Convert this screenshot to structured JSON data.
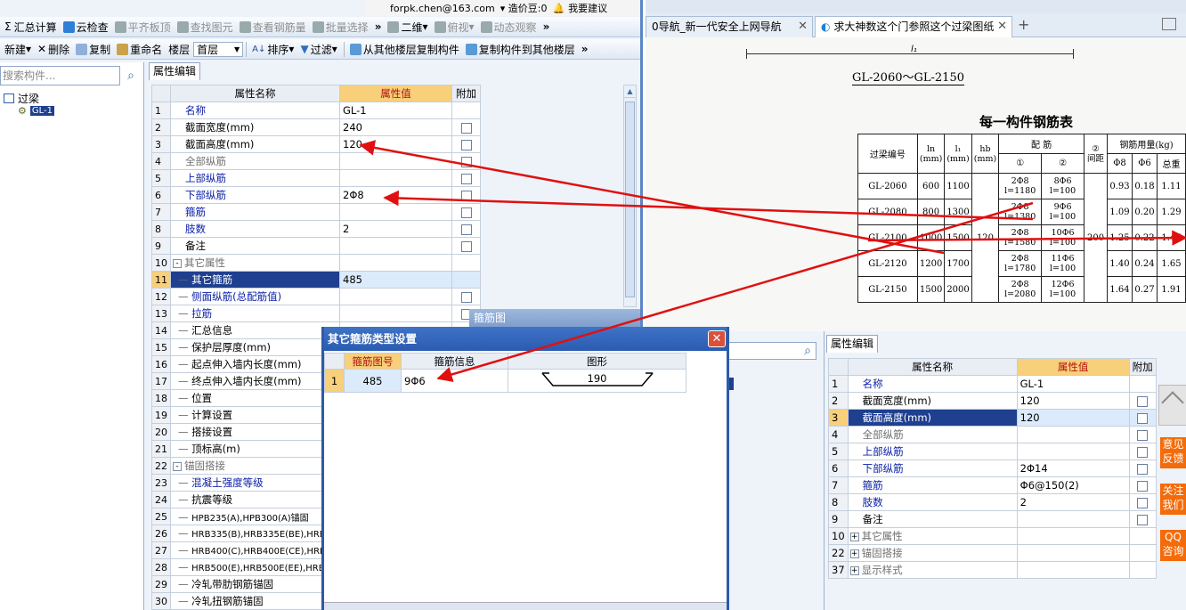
{
  "left_app": {
    "email": "forpk.chen@163.com",
    "email_suffix": "▾ 造价豆:0",
    "suggest": "我要建议",
    "toolbar1": [
      "汇总计算",
      "云检查",
      "平齐板顶",
      "查找图元",
      "查看钢筋量",
      "批量选择",
      "二维",
      "俯视",
      "动态观察"
    ],
    "toolbar2": {
      "new": "新建",
      "delete": "删除",
      "copy": "复制",
      "rename": "重命名",
      "floor_label": "楼层",
      "floor_value": "首层",
      "sort": "排序",
      "filter": "过滤",
      "copy_from": "从其他楼层复制构件",
      "copy_to": "复制构件到其他楼层"
    },
    "search_placeholder": "搜索构件...",
    "tree": {
      "root": "过梁",
      "child": "GL-1"
    },
    "prop_tab": "属性编辑",
    "grid_headers": [
      "属性名称",
      "属性值",
      "附加"
    ],
    "rows": [
      {
        "n": "1",
        "name": "名称",
        "val": "GL-1",
        "cls": "blue",
        "cb": false
      },
      {
        "n": "2",
        "name": "截面宽度(mm)",
        "val": "240",
        "cls": "",
        "cb": true
      },
      {
        "n": "3",
        "name": "截面高度(mm)",
        "val": "120",
        "cls": "",
        "cb": true
      },
      {
        "n": "4",
        "name": "全部纵筋",
        "val": "",
        "cls": "gray",
        "cb": true
      },
      {
        "n": "5",
        "name": "上部纵筋",
        "val": "",
        "cls": "blue",
        "cb": true
      },
      {
        "n": "6",
        "name": "下部纵筋",
        "val": "2Φ8",
        "cls": "blue",
        "cb": true
      },
      {
        "n": "7",
        "name": "箍筋",
        "val": "",
        "cls": "blue",
        "cb": true
      },
      {
        "n": "8",
        "name": "肢数",
        "val": "2",
        "cls": "blue",
        "cb": true
      },
      {
        "n": "9",
        "name": "备注",
        "val": "",
        "cls": "",
        "cb": true
      },
      {
        "n": "10",
        "name": "其它属性",
        "val": "",
        "cls": "gray",
        "cb": false,
        "group": "-"
      },
      {
        "n": "11",
        "name": "其它箍筋",
        "val": "485",
        "cls": "",
        "cb": false,
        "indent": true,
        "hl": true
      },
      {
        "n": "12",
        "name": "侧面纵筋(总配筋值)",
        "val": "",
        "cls": "blue",
        "cb": true,
        "indent": true
      },
      {
        "n": "13",
        "name": "拉筋",
        "val": "",
        "cls": "blue",
        "cb": true,
        "indent": true
      },
      {
        "n": "14",
        "name": "汇总信息",
        "val": "",
        "cls": "",
        "cb": false,
        "indent": true
      },
      {
        "n": "15",
        "name": "保护层厚度(mm)",
        "val": "",
        "cls": "",
        "cb": false,
        "indent": true
      },
      {
        "n": "16",
        "name": "起点伸入墙内长度(mm)",
        "val": "",
        "cls": "",
        "cb": false,
        "indent": true
      },
      {
        "n": "17",
        "name": "终点伸入墙内长度(mm)",
        "val": "",
        "cls": "",
        "cb": false,
        "indent": true
      },
      {
        "n": "18",
        "name": "位置",
        "val": "",
        "cls": "",
        "cb": false,
        "indent": true
      },
      {
        "n": "19",
        "name": "计算设置",
        "val": "",
        "cls": "",
        "cb": false,
        "indent": true
      },
      {
        "n": "20",
        "name": "搭接设置",
        "val": "",
        "cls": "",
        "cb": false,
        "indent": true
      },
      {
        "n": "21",
        "name": "顶标高(m)",
        "val": "",
        "cls": "",
        "cb": false,
        "indent": true
      },
      {
        "n": "22",
        "name": "锚固搭接",
        "val": "",
        "cls": "gray",
        "cb": false,
        "group": "-"
      },
      {
        "n": "23",
        "name": "混凝土强度等级",
        "val": "",
        "cls": "blue",
        "cb": false,
        "indent": true
      },
      {
        "n": "24",
        "name": "抗震等级",
        "val": "",
        "cls": "",
        "cb": false,
        "indent": true
      },
      {
        "n": "25",
        "name": "HPB235(A),HPB300(A)锚固",
        "val": "",
        "cls": "",
        "cb": false,
        "indent": true,
        "small": true
      },
      {
        "n": "26",
        "name": "HRB335(B),HRB335E(BE),HRBF",
        "val": "",
        "cls": "",
        "cb": false,
        "indent": true,
        "small": true
      },
      {
        "n": "27",
        "name": "HRB400(C),HRB400E(CE),HRBF",
        "val": "",
        "cls": "",
        "cb": false,
        "indent": true,
        "small": true
      },
      {
        "n": "28",
        "name": "HRB500(E),HRB500E(EE),HRBF",
        "val": "",
        "cls": "",
        "cb": false,
        "indent": true,
        "small": true
      },
      {
        "n": "29",
        "name": "冷轧带肋钢筋锚固",
        "val": "",
        "cls": "",
        "cb": false,
        "indent": true
      },
      {
        "n": "30",
        "name": "冷轧扭钢筋锚固",
        "val": "",
        "cls": "",
        "cb": false,
        "indent": true
      }
    ],
    "stirrup_strip": "箍筋图"
  },
  "browser": {
    "tab1": "0导航_新一代安全上网导航",
    "tab2": "求大神数这个门参照这个过梁图纸",
    "dim_label": "l₁",
    "doc_title": "GL-2060～GL-2150",
    "table_title": "每一构件钢筋表",
    "table_head": {
      "beam": "过梁编号",
      "ln": "ln",
      "l1": "l₁",
      "hb": "hb",
      "mm": "(mm)",
      "rebar": "配  筋",
      "spacing_head": "②",
      "spacing": "间距",
      "usage": "钢筋用量(kg)",
      "c1": "①",
      "c2": "②",
      "d8": "Φ8",
      "d6": "Φ6",
      "total": "总重"
    },
    "table_rows": [
      {
        "id": "GL-2060",
        "ln": "600",
        "l1": "1100",
        "r1a": "2Φ8",
        "r1b": "l=1180",
        "r2a": "8Φ6",
        "r2b": "l=100",
        "a": "0.93",
        "b": "0.18",
        "t": "1.11"
      },
      {
        "id": "GL-2080",
        "ln": "800",
        "l1": "1300",
        "r1a": "2Φ8",
        "r1b": "l=1380",
        "r2a": "9Φ6",
        "r2b": "l=100",
        "a": "1.09",
        "b": "0.20",
        "t": "1.29"
      },
      {
        "id": "GL-2100",
        "ln": "1000",
        "l1": "1500",
        "r1a": "2Φ8",
        "r1b": "l=1580",
        "r2a": "10Φ6",
        "r2b": "l=100",
        "a": "1.25",
        "b": "0.22",
        "t": "1.47"
      },
      {
        "id": "GL-2120",
        "ln": "1200",
        "l1": "1700",
        "r1a": "2Φ8",
        "r1b": "l=1780",
        "r2a": "11Φ6",
        "r2b": "l=100",
        "a": "1.40",
        "b": "0.24",
        "t": "1.65"
      },
      {
        "id": "GL-2150",
        "ln": "1500",
        "l1": "2000",
        "r1a": "2Φ8",
        "r1b": "l=2080",
        "r2a": "12Φ6",
        "r2b": "l=100",
        "a": "1.64",
        "b": "0.27",
        "t": "1.91"
      }
    ],
    "table_hb": "120",
    "table_spacing": "200",
    "prop_tab": "属性编辑",
    "grid_headers": [
      "属性名称",
      "属性值",
      "附加"
    ],
    "rows": [
      {
        "n": "1",
        "name": "名称",
        "val": "GL-1",
        "cls": "blue",
        "cb": false
      },
      {
        "n": "2",
        "name": "截面宽度(mm)",
        "val": "120",
        "cls": "",
        "cb": true
      },
      {
        "n": "3",
        "name": "截面高度(mm)",
        "val": "120",
        "cls": "",
        "cb": true,
        "hl": true
      },
      {
        "n": "4",
        "name": "全部纵筋",
        "val": "",
        "cls": "gray",
        "cb": true
      },
      {
        "n": "5",
        "name": "上部纵筋",
        "val": "",
        "cls": "blue",
        "cb": true
      },
      {
        "n": "6",
        "name": "下部纵筋",
        "val": "2Φ14",
        "cls": "blue",
        "cb": true
      },
      {
        "n": "7",
        "name": "箍筋",
        "val": "Φ6@150(2)",
        "cls": "blue",
        "cb": true
      },
      {
        "n": "8",
        "name": "肢数",
        "val": "2",
        "cls": "blue",
        "cb": true
      },
      {
        "n": "9",
        "name": "备注",
        "val": "",
        "cls": "",
        "cb": true
      },
      {
        "n": "10",
        "name": "其它属性",
        "val": "",
        "cls": "gray",
        "cb": false,
        "group": "+"
      },
      {
        "n": "22",
        "name": "锚固搭接",
        "val": "",
        "cls": "gray",
        "cb": false,
        "group": "+"
      },
      {
        "n": "37",
        "name": "显示样式",
        "val": "",
        "cls": "gray",
        "cb": false,
        "group": "+"
      }
    ],
    "side_buttons": [
      "意见反馈",
      "关注我们",
      "QQ咨询"
    ]
  },
  "dialog": {
    "title": "其它箍筋类型设置",
    "close": "✕",
    "headers": [
      "箍筋图号",
      "箍筋信息",
      "图形"
    ],
    "row": {
      "n": "1",
      "code": "485",
      "info": "9Φ6",
      "shape_value": "190"
    }
  },
  "colors": {
    "arrow": "#e01010",
    "accent": "#2e5aa8",
    "orange": "#f46b0a"
  }
}
